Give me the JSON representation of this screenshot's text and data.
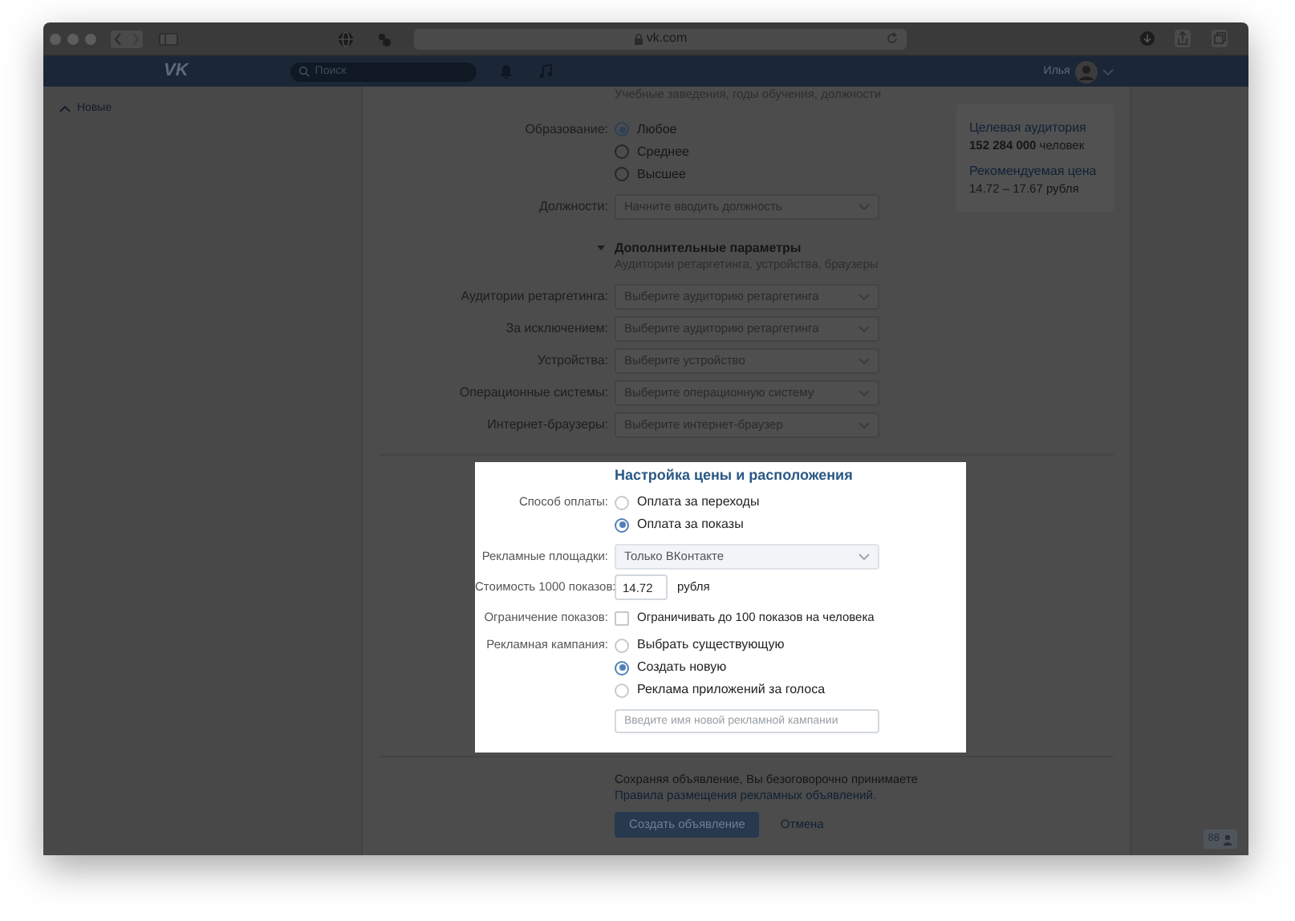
{
  "browser": {
    "address": "vk.com"
  },
  "header": {
    "logo": "VK",
    "search_placeholder": "Поиск",
    "user_name": "Илья"
  },
  "sidebar": {
    "items": [
      {
        "label": "Новые"
      }
    ]
  },
  "targeting": {
    "hint": "Учебные заведения, годы обучения, должности",
    "education": {
      "label": "Образование:",
      "options": [
        {
          "label": "Любое",
          "selected": true
        },
        {
          "label": "Среднее",
          "selected": false
        },
        {
          "label": "Высшее",
          "selected": false
        }
      ]
    },
    "positions": {
      "label": "Должности:",
      "placeholder": "Начните вводить должность"
    },
    "extra": {
      "title": "Дополнительные параметры",
      "expanded": true,
      "hint": "Аудитории ретаргетинга, устройства, браузеры",
      "fields": [
        {
          "label": "Аудитории ретаргетинга:",
          "placeholder": "Выберите аудиторию ретаргетинга"
        },
        {
          "label": "За исключением:",
          "placeholder": "Выберите аудиторию ретаргетинга"
        },
        {
          "label": "Устройства:",
          "placeholder": "Выберите устройство"
        },
        {
          "label": "Операционные системы:",
          "placeholder": "Выберите операционную систему"
        },
        {
          "label": "Интернет-браузеры:",
          "placeholder": "Выберите интернет-браузер"
        }
      ]
    }
  },
  "audience_panel": {
    "items": [
      {
        "title": "Целевая аудитория",
        "value": "**152 284 000** человек"
      },
      {
        "title": "Рекомендуемая цена",
        "value": "14.72 – 17.67 рубля"
      }
    ]
  },
  "pricing": {
    "title": "Настройка цены и расположения",
    "payment": {
      "label": "Способ оплаты:",
      "options": [
        {
          "label": "Оплата за переходы",
          "selected": false
        },
        {
          "label": "Оплата за показы",
          "selected": true
        }
      ]
    },
    "platforms": {
      "label": "Рекламные площадки:",
      "value": "Только ВКонтакте"
    },
    "cost": {
      "label": "Стоимость 1000 показов:",
      "value": "14.72",
      "unit": "рубля"
    },
    "limit": {
      "label": "Ограничение показов:",
      "text": "Ограничивать до 100 показов на человека",
      "checked": false
    },
    "campaign": {
      "label": "Рекламная кампания:",
      "options": [
        {
          "label": "Выбрать существующую",
          "selected": false
        },
        {
          "label": "Создать новую",
          "selected": true
        },
        {
          "label": "Реклама приложений за голоса",
          "selected": false
        }
      ],
      "name_placeholder": "Введите имя новой рекламной кампании"
    }
  },
  "footer": {
    "note": "Сохраняя объявление, Вы безоговорочно принимаете",
    "rules_link": "Правила размещения рекламных объявлений.",
    "create_button": "Создать объявление",
    "cancel_button": "Отмена"
  },
  "chat_badge": {
    "count": "88"
  }
}
